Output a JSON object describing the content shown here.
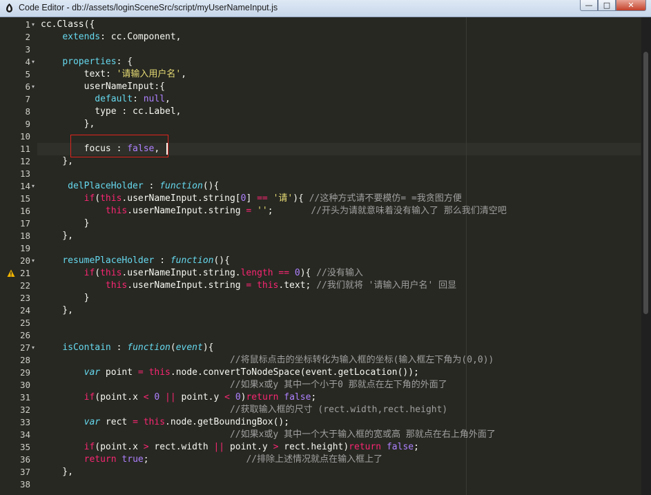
{
  "window": {
    "title": "Code Editor - db://assets/loginSceneSrc/script/myUserNameInput.js",
    "buttons": {
      "minimize": "—",
      "maximize": "□",
      "close": "✕"
    }
  },
  "icons": {
    "app": "code-editor-logo-icon",
    "warning": "warning-triangle-icon"
  },
  "editor": {
    "line_numbers": [
      "1",
      "2",
      "3",
      "4",
      "5",
      "6",
      "7",
      "8",
      "9",
      "10",
      "11",
      "12",
      "13",
      "14",
      "15",
      "16",
      "17",
      "18",
      "19",
      "20",
      "21",
      "22",
      "23",
      "24",
      "25",
      "26",
      "27",
      "28",
      "29",
      "30",
      "31",
      "32",
      "33",
      "34",
      "35",
      "36",
      "37",
      "38"
    ],
    "warning_line": "21",
    "current_line": "11"
  },
  "colors": {
    "background": "#272822",
    "keyword": "#f92672",
    "string": "#e6db74",
    "number": "#ae81ff",
    "identifier": "#66d9ef",
    "highlight_box": "#e0241d"
  }
}
